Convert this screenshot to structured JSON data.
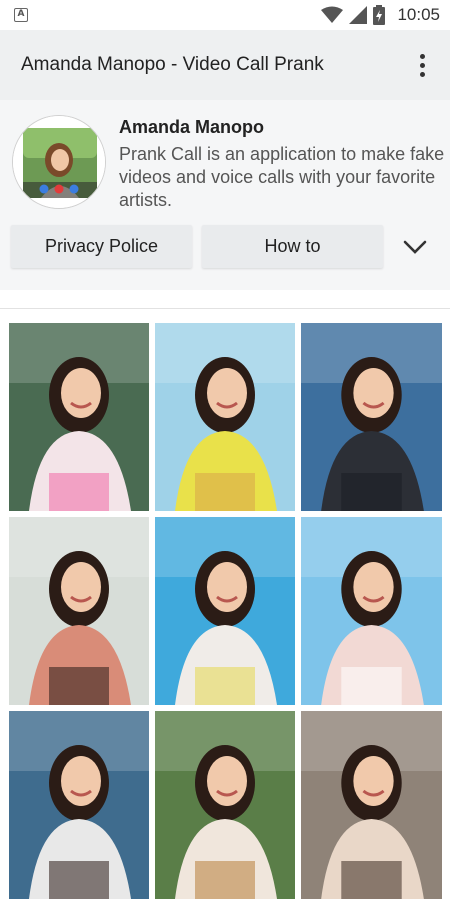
{
  "status_bar": {
    "time": "10:05",
    "app_icon_letter": "A",
    "icons": [
      "notification-app-icon",
      "wifi-icon",
      "cellular-signal-icon",
      "battery-charging-icon"
    ]
  },
  "app_bar": {
    "title": "Amanda Manopo - Video Call Prank",
    "menu_icon": "overflow-menu-icon"
  },
  "header": {
    "name": "Amanda Manopo",
    "description": "Prank Call is an application to make fake videos and voice calls with your favorite artists.",
    "buttons": {
      "privacy_label": "Privacy Police",
      "howto_label": "How to"
    },
    "expand_icon": "chevron-down-icon"
  },
  "gallery": {
    "photos": [
      {
        "bg": "#4a6b52",
        "shirt": "#f3e4e8",
        "accent": "#f06aa6"
      },
      {
        "bg": "#9fd2e8",
        "shirt": "#e9e14a",
        "accent": "#d8a54a"
      },
      {
        "bg": "#3d6f9e",
        "shirt": "#2c2f36",
        "accent": "#1b1e24"
      },
      {
        "bg": "#d7ddd8",
        "shirt": "#d98c78",
        "accent": "#2a1c18"
      },
      {
        "bg": "#3fa9dc",
        "shirt": "#f0ece8",
        "accent": "#e6d94f"
      },
      {
        "bg": "#7ec4ea",
        "shirt": "#f2d9d4",
        "accent": "#ffffff"
      },
      {
        "bg": "#3f6c8e",
        "shirt": "#e8e8e8",
        "accent": "#2a1a16"
      },
      {
        "bg": "#5a7e48",
        "shirt": "#f0e6dc",
        "accent": "#b87e3a"
      },
      {
        "bg": "#8f8378",
        "shirt": "#e9d7c8",
        "accent": "#3a2a20"
      }
    ]
  }
}
